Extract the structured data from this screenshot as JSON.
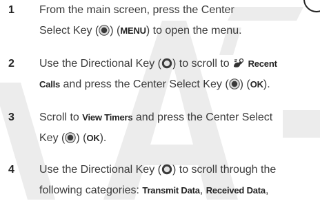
{
  "watermark": "DRAFT",
  "steps": [
    {
      "number": "1",
      "t1": "From the main screen, press the Center",
      "t2": "Select Key (",
      "t3": ") (",
      "k1": "MENU",
      "t4": ") to open the menu."
    },
    {
      "number": "2",
      "t1": "Use the Directional Key (",
      "t2": ") to scroll to ",
      "k1": "Recent",
      "k2": "Calls",
      "t3": " and press the Center Select Key (",
      "t4": ") (",
      "k3": "OK",
      "t5": ")."
    },
    {
      "number": "3",
      "t1": "Scroll to ",
      "k1": "View Timers",
      "t2": " and press the Center Select",
      "t3": "Key (",
      "t4": ") (",
      "k2": "OK",
      "t5": ")."
    },
    {
      "number": "4",
      "t1": "Use the Directional Key (",
      "t2": ") to scroll through the",
      "t3": "following categories: ",
      "k1": "Transmit Data",
      "t4": ", ",
      "k2": "Received Data",
      "t5": ","
    }
  ],
  "icons": {
    "center_select": "center-select-key-icon",
    "directional": "directional-key-icon",
    "recent_calls": "recent-calls-icon"
  }
}
